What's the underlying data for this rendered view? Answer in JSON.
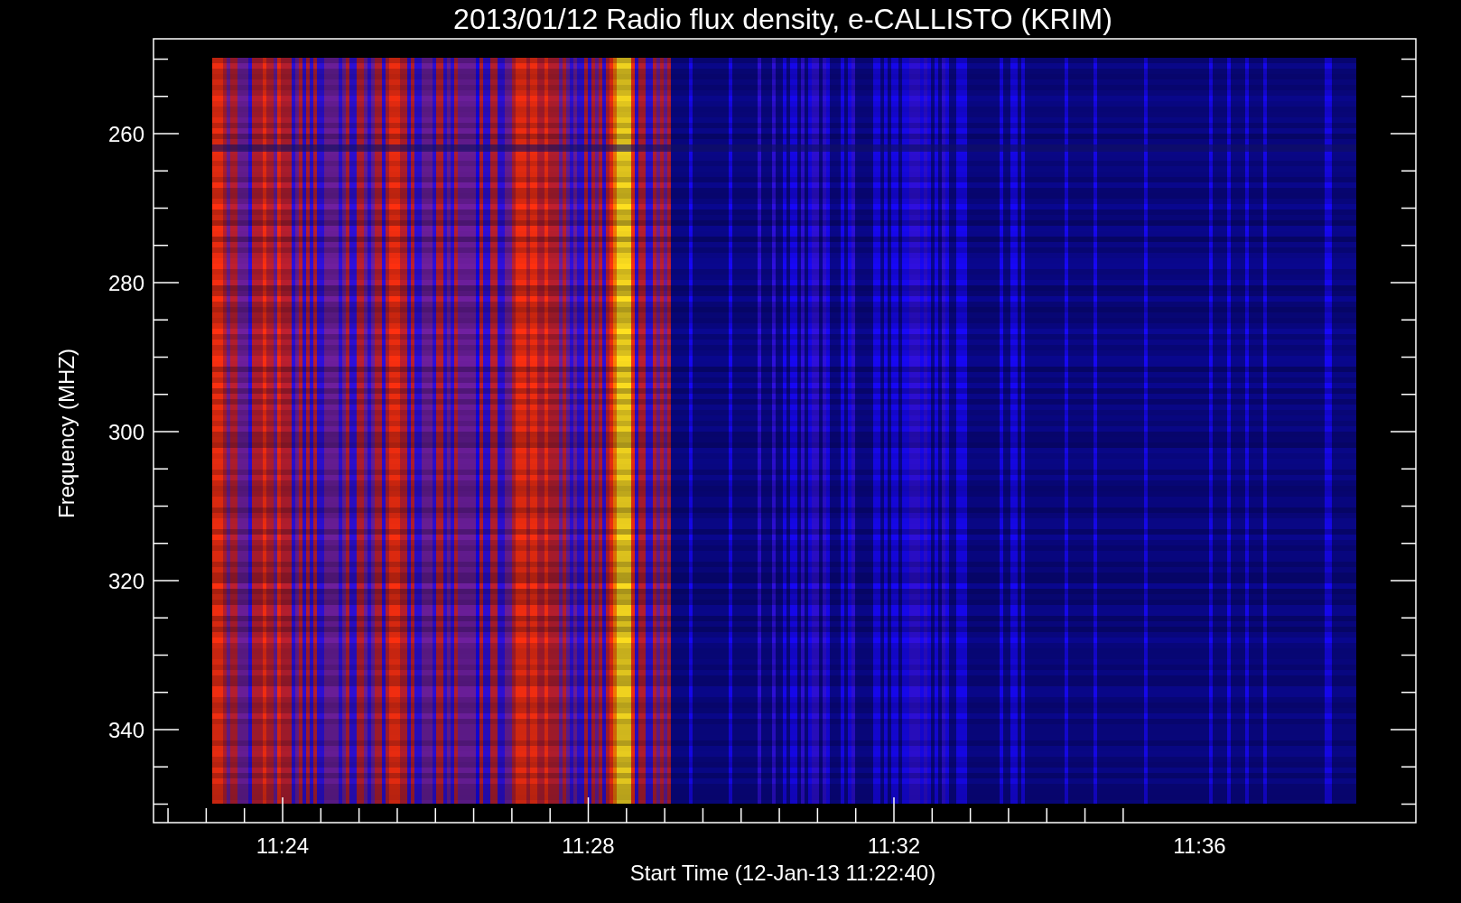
{
  "title": "2013/01/12  Radio flux density, e-CALLISTO (KRIM)",
  "y_axis": {
    "label": "Frequency (MHZ)",
    "ticks": [
      "260",
      "280",
      "300",
      "320",
      "340"
    ]
  },
  "x_axis": {
    "label": "Start Time (12-Jan-13 11:22:40)",
    "ticks": [
      "11:24",
      "11:28",
      "11:32",
      "11:36"
    ]
  }
}
